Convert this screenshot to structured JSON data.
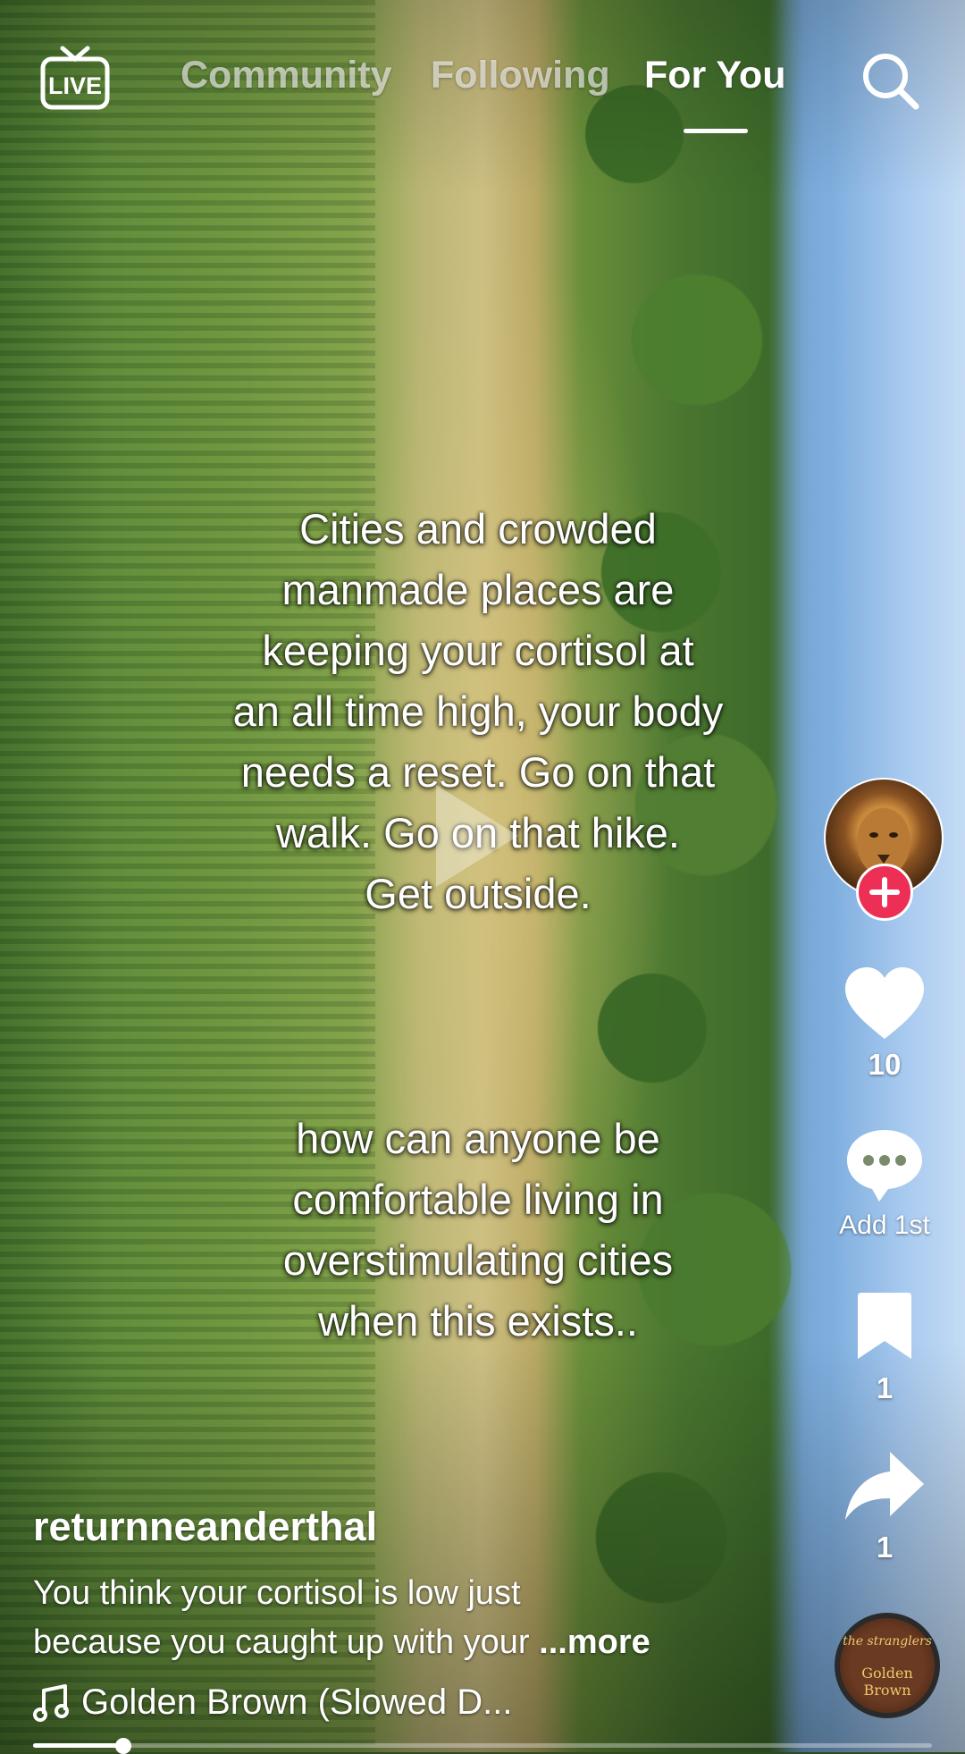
{
  "header": {
    "live_label": "LIVE",
    "tabs": [
      "Community",
      "Following",
      "For You"
    ],
    "active_tab": "For You",
    "search_icon": "search-icon"
  },
  "video": {
    "overlay_text_1": [
      "Cities and crowded",
      "manmade places are",
      "keeping your cortisol at",
      "an all time high, your body",
      "needs a reset. Go on that",
      "walk. Go on that hike.",
      "Get outside."
    ],
    "overlay_text_2": [
      "how can anyone be",
      "comfortable living in",
      "overstimulating cities",
      "when this exists.."
    ]
  },
  "rail": {
    "avatar_icon": "lion-avatar",
    "follow_icon": "plus-icon",
    "like_count": "10",
    "comment_label": "Add 1st",
    "save_count": "1",
    "share_count": "1",
    "music_disc": {
      "band": "the stranglers",
      "title": "Golden Brown"
    }
  },
  "post": {
    "username": "returnneanderthal",
    "caption_line1": "You think your cortisol is low just",
    "caption_line2": "because you caught up with your ",
    "more_label": "...more",
    "music_title": "Golden Brown (Slowed D...",
    "progress": 0.1
  },
  "colors": {
    "accent": "#ee2f55",
    "text": "#ffffff"
  }
}
